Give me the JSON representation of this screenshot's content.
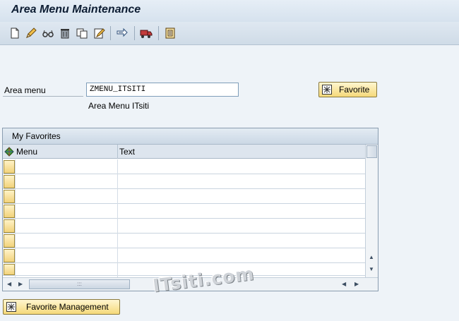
{
  "window": {
    "title": "Area Menu Maintenance"
  },
  "toolbar": {
    "icons": [
      "new-document-icon",
      "edit-pencil-icon",
      "display-glasses-icon",
      "delete-trash-icon",
      "copy-icon",
      "change-document-icon",
      "transport-arrow-icon",
      "transport-truck-icon",
      "translation-icon"
    ]
  },
  "form": {
    "area_menu_label": "Area menu",
    "area_menu_value": "ZMENU_ITSITI",
    "area_menu_description": "Area Menu ITsiti",
    "favorite_button": "Favorite"
  },
  "table": {
    "title": "My Favorites",
    "columns": [
      "Menu",
      "Text"
    ],
    "rows": [
      {
        "menu": "",
        "text": ""
      },
      {
        "menu": "",
        "text": ""
      },
      {
        "menu": "",
        "text": ""
      },
      {
        "menu": "",
        "text": ""
      },
      {
        "menu": "",
        "text": ""
      },
      {
        "menu": "",
        "text": ""
      },
      {
        "menu": "",
        "text": ""
      },
      {
        "menu": "",
        "text": ""
      }
    ],
    "hscroll_grip": ":::"
  },
  "footer": {
    "favorite_management_button": "Favorite Management"
  },
  "watermark": "ITsiti.com",
  "colors": {
    "button_yellow": "#f5d97a",
    "title": "#0d1d33",
    "background": "#eef3f8"
  }
}
